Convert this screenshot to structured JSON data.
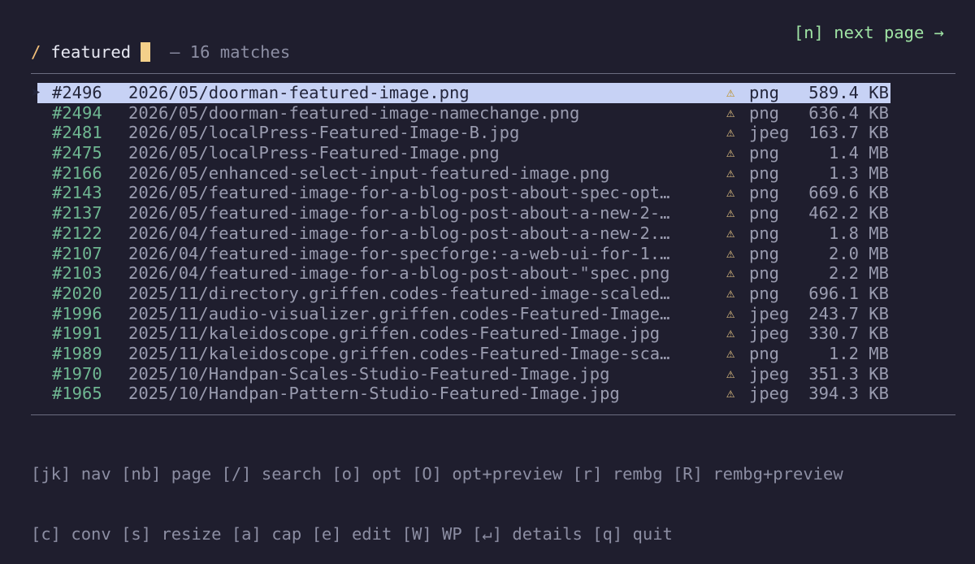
{
  "header": {
    "next_page": "[n] next page →",
    "prompt_symbol": "/",
    "query": "featured",
    "match_count": "— 16 matches"
  },
  "icons": {
    "selection": "triangle-right-icon",
    "warning": "warning-icon"
  },
  "colors": {
    "background": "#1f1e2e",
    "accent_green": "#9fe3a4",
    "selection": "#c7d2f5",
    "cursor": "#f4d08a"
  },
  "results": [
    {
      "id": "#2496",
      "path": "2026/05/doorman-featured-image.png",
      "warn": "⚠",
      "format": "png",
      "size": "589.4 KB",
      "selected": true
    },
    {
      "id": "#2494",
      "path": "2026/05/doorman-featured-image-namechange.png",
      "warn": "⚠",
      "format": "png",
      "size": "636.4 KB"
    },
    {
      "id": "#2481",
      "path": "2026/05/localPress-Featured-Image-B.jpg",
      "warn": "⚠",
      "format": "jpeg",
      "size": "163.7 KB"
    },
    {
      "id": "#2475",
      "path": "2026/05/localPress-Featured-Image.png",
      "warn": "⚠",
      "format": "png",
      "size": "1.4 MB"
    },
    {
      "id": "#2166",
      "path": "2026/05/enhanced-select-input-featured-image.png",
      "warn": "⚠",
      "format": "png",
      "size": "1.3 MB"
    },
    {
      "id": "#2143",
      "path": "2026/05/featured-image-for-a-blog-post-about-spec-opt…",
      "warn": "⚠",
      "format": "png",
      "size": "669.6 KB"
    },
    {
      "id": "#2137",
      "path": "2026/05/featured-image-for-a-blog-post-about-a-new-2-…",
      "warn": "⚠",
      "format": "png",
      "size": "462.2 KB"
    },
    {
      "id": "#2122",
      "path": "2026/04/featured-image-for-a-blog-post-about-a-new-2.…",
      "warn": "⚠",
      "format": "png",
      "size": "1.8 MB"
    },
    {
      "id": "#2107",
      "path": "2026/04/featured-image-for-specforge:-a-web-ui-for-1.…",
      "warn": "⚠",
      "format": "png",
      "size": "2.0 MB"
    },
    {
      "id": "#2103",
      "path": "2026/04/featured-image-for-a-blog-post-about-\"spec.png",
      "warn": "⚠",
      "format": "png",
      "size": "2.2 MB"
    },
    {
      "id": "#2020",
      "path": "2025/11/directory.griffen.codes-featured-image-scaled…",
      "warn": "⚠",
      "format": "png",
      "size": "696.1 KB"
    },
    {
      "id": "#1996",
      "path": "2025/11/audio-visualizer.griffen.codes-Featured-Image…",
      "warn": "⚠",
      "format": "jpeg",
      "size": "243.7 KB"
    },
    {
      "id": "#1991",
      "path": "2025/11/kaleidoscope.griffen.codes-Featured-Image.jpg",
      "warn": "⚠",
      "format": "jpeg",
      "size": "330.7 KB"
    },
    {
      "id": "#1989",
      "path": "2025/11/kaleidoscope.griffen.codes-Featured-Image-sca…",
      "warn": "⚠",
      "format": "png",
      "size": "1.2 MB"
    },
    {
      "id": "#1970",
      "path": "2025/10/Handpan-Scales-Studio-Featured-Image.jpg",
      "warn": "⚠",
      "format": "jpeg",
      "size": "351.3 KB"
    },
    {
      "id": "#1965",
      "path": "2025/10/Handpan-Pattern-Studio-Featured-Image.jpg",
      "warn": "⚠",
      "format": "jpeg",
      "size": "394.3 KB"
    }
  ],
  "help": {
    "line1": "[jk] nav [nb] page [/] search [o] opt [O] opt+preview [r] rembg [R] rembg+preview",
    "line2": "[c] conv [s] resize [a] cap [e] edit [W] WP [↵] details [q] quit"
  }
}
